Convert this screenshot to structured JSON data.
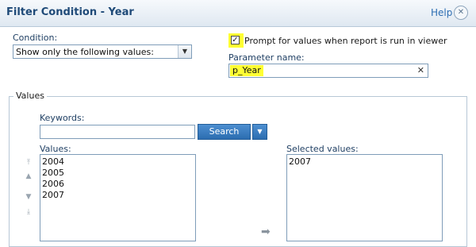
{
  "dialog": {
    "title": "Filter Condition - Year",
    "help_label": "Help",
    "close_glyph": "✕"
  },
  "condition": {
    "label": "Condition:",
    "selected": "Show only the following values:",
    "arrow_glyph": "▼"
  },
  "prompt": {
    "checked": true,
    "check_glyph": "✓",
    "label": "Prompt for values when report is run in viewer"
  },
  "parameter": {
    "label": "Parameter name:",
    "value": "p_Year",
    "clear_glyph": "✕"
  },
  "values_group": {
    "legend": "Values",
    "keywords_label": "Keywords:",
    "keywords_value": "",
    "search_label": "Search",
    "search_arrow_glyph": "▼",
    "values_label": "Values:",
    "values": [
      "2004",
      "2005",
      "2006",
      "2007"
    ],
    "selected_label": "Selected values:",
    "selected": [
      "2007"
    ],
    "order_buttons": [
      {
        "name": "move-top-icon",
        "glyph": "⤒"
      },
      {
        "name": "move-up-icon",
        "glyph": "▲"
      },
      {
        "name": "move-down-icon",
        "glyph": "▼"
      },
      {
        "name": "move-bottom-icon",
        "glyph": "⤓"
      }
    ],
    "move_right_glyph": "➡"
  },
  "colors": {
    "title": "#1f4a78",
    "link": "#2d6eb3",
    "highlight": "#ffff33",
    "button": "#2c6db0"
  }
}
